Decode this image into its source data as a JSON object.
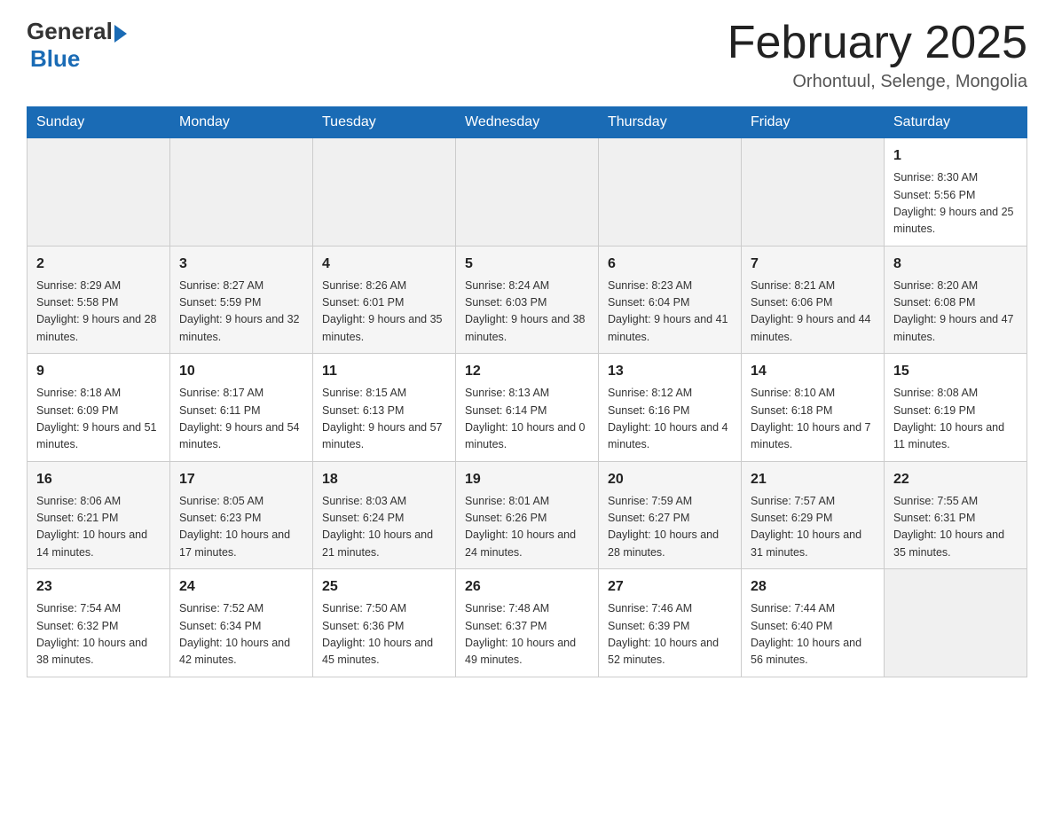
{
  "header": {
    "logo_general": "General",
    "logo_blue": "Blue",
    "month_title": "February 2025",
    "location": "Orhontuul, Selenge, Mongolia"
  },
  "weekdays": [
    "Sunday",
    "Monday",
    "Tuesday",
    "Wednesday",
    "Thursday",
    "Friday",
    "Saturday"
  ],
  "weeks": [
    [
      {
        "day": "",
        "info": ""
      },
      {
        "day": "",
        "info": ""
      },
      {
        "day": "",
        "info": ""
      },
      {
        "day": "",
        "info": ""
      },
      {
        "day": "",
        "info": ""
      },
      {
        "day": "",
        "info": ""
      },
      {
        "day": "1",
        "info": "Sunrise: 8:30 AM\nSunset: 5:56 PM\nDaylight: 9 hours and 25 minutes."
      }
    ],
    [
      {
        "day": "2",
        "info": "Sunrise: 8:29 AM\nSunset: 5:58 PM\nDaylight: 9 hours and 28 minutes."
      },
      {
        "day": "3",
        "info": "Sunrise: 8:27 AM\nSunset: 5:59 PM\nDaylight: 9 hours and 32 minutes."
      },
      {
        "day": "4",
        "info": "Sunrise: 8:26 AM\nSunset: 6:01 PM\nDaylight: 9 hours and 35 minutes."
      },
      {
        "day": "5",
        "info": "Sunrise: 8:24 AM\nSunset: 6:03 PM\nDaylight: 9 hours and 38 minutes."
      },
      {
        "day": "6",
        "info": "Sunrise: 8:23 AM\nSunset: 6:04 PM\nDaylight: 9 hours and 41 minutes."
      },
      {
        "day": "7",
        "info": "Sunrise: 8:21 AM\nSunset: 6:06 PM\nDaylight: 9 hours and 44 minutes."
      },
      {
        "day": "8",
        "info": "Sunrise: 8:20 AM\nSunset: 6:08 PM\nDaylight: 9 hours and 47 minutes."
      }
    ],
    [
      {
        "day": "9",
        "info": "Sunrise: 8:18 AM\nSunset: 6:09 PM\nDaylight: 9 hours and 51 minutes."
      },
      {
        "day": "10",
        "info": "Sunrise: 8:17 AM\nSunset: 6:11 PM\nDaylight: 9 hours and 54 minutes."
      },
      {
        "day": "11",
        "info": "Sunrise: 8:15 AM\nSunset: 6:13 PM\nDaylight: 9 hours and 57 minutes."
      },
      {
        "day": "12",
        "info": "Sunrise: 8:13 AM\nSunset: 6:14 PM\nDaylight: 10 hours and 0 minutes."
      },
      {
        "day": "13",
        "info": "Sunrise: 8:12 AM\nSunset: 6:16 PM\nDaylight: 10 hours and 4 minutes."
      },
      {
        "day": "14",
        "info": "Sunrise: 8:10 AM\nSunset: 6:18 PM\nDaylight: 10 hours and 7 minutes."
      },
      {
        "day": "15",
        "info": "Sunrise: 8:08 AM\nSunset: 6:19 PM\nDaylight: 10 hours and 11 minutes."
      }
    ],
    [
      {
        "day": "16",
        "info": "Sunrise: 8:06 AM\nSunset: 6:21 PM\nDaylight: 10 hours and 14 minutes."
      },
      {
        "day": "17",
        "info": "Sunrise: 8:05 AM\nSunset: 6:23 PM\nDaylight: 10 hours and 17 minutes."
      },
      {
        "day": "18",
        "info": "Sunrise: 8:03 AM\nSunset: 6:24 PM\nDaylight: 10 hours and 21 minutes."
      },
      {
        "day": "19",
        "info": "Sunrise: 8:01 AM\nSunset: 6:26 PM\nDaylight: 10 hours and 24 minutes."
      },
      {
        "day": "20",
        "info": "Sunrise: 7:59 AM\nSunset: 6:27 PM\nDaylight: 10 hours and 28 minutes."
      },
      {
        "day": "21",
        "info": "Sunrise: 7:57 AM\nSunset: 6:29 PM\nDaylight: 10 hours and 31 minutes."
      },
      {
        "day": "22",
        "info": "Sunrise: 7:55 AM\nSunset: 6:31 PM\nDaylight: 10 hours and 35 minutes."
      }
    ],
    [
      {
        "day": "23",
        "info": "Sunrise: 7:54 AM\nSunset: 6:32 PM\nDaylight: 10 hours and 38 minutes."
      },
      {
        "day": "24",
        "info": "Sunrise: 7:52 AM\nSunset: 6:34 PM\nDaylight: 10 hours and 42 minutes."
      },
      {
        "day": "25",
        "info": "Sunrise: 7:50 AM\nSunset: 6:36 PM\nDaylight: 10 hours and 45 minutes."
      },
      {
        "day": "26",
        "info": "Sunrise: 7:48 AM\nSunset: 6:37 PM\nDaylight: 10 hours and 49 minutes."
      },
      {
        "day": "27",
        "info": "Sunrise: 7:46 AM\nSunset: 6:39 PM\nDaylight: 10 hours and 52 minutes."
      },
      {
        "day": "28",
        "info": "Sunrise: 7:44 AM\nSunset: 6:40 PM\nDaylight: 10 hours and 56 minutes."
      },
      {
        "day": "",
        "info": ""
      }
    ]
  ]
}
